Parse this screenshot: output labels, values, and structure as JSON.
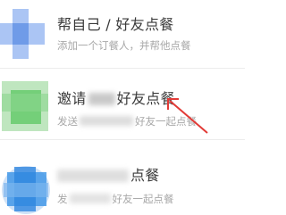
{
  "options": [
    {
      "title": "帮自己 / 好友点餐",
      "subtitle": "添加一个订餐人，并帮他点餐",
      "icon": "person-add-icon",
      "icon_color": "#8fb2f0"
    },
    {
      "title_prefix": "邀请",
      "title_suffix": "好友点餐",
      "subtitle_prefix": "发送",
      "subtitle_suffix": "好友一起点餐",
      "icon": "wechat-icon",
      "icon_color": "#6ccb71"
    },
    {
      "title": "点餐",
      "subtitle_prefix": "发",
      "subtitle_suffix": "好友一起点餐",
      "icon": "qq-icon",
      "icon_color": "#3a93e6"
    }
  ],
  "colors": {
    "annotation_arrow": "#e23a36",
    "divider": "#ececec",
    "title": "#3a3a3a",
    "subtitle": "#a8a8a8"
  }
}
